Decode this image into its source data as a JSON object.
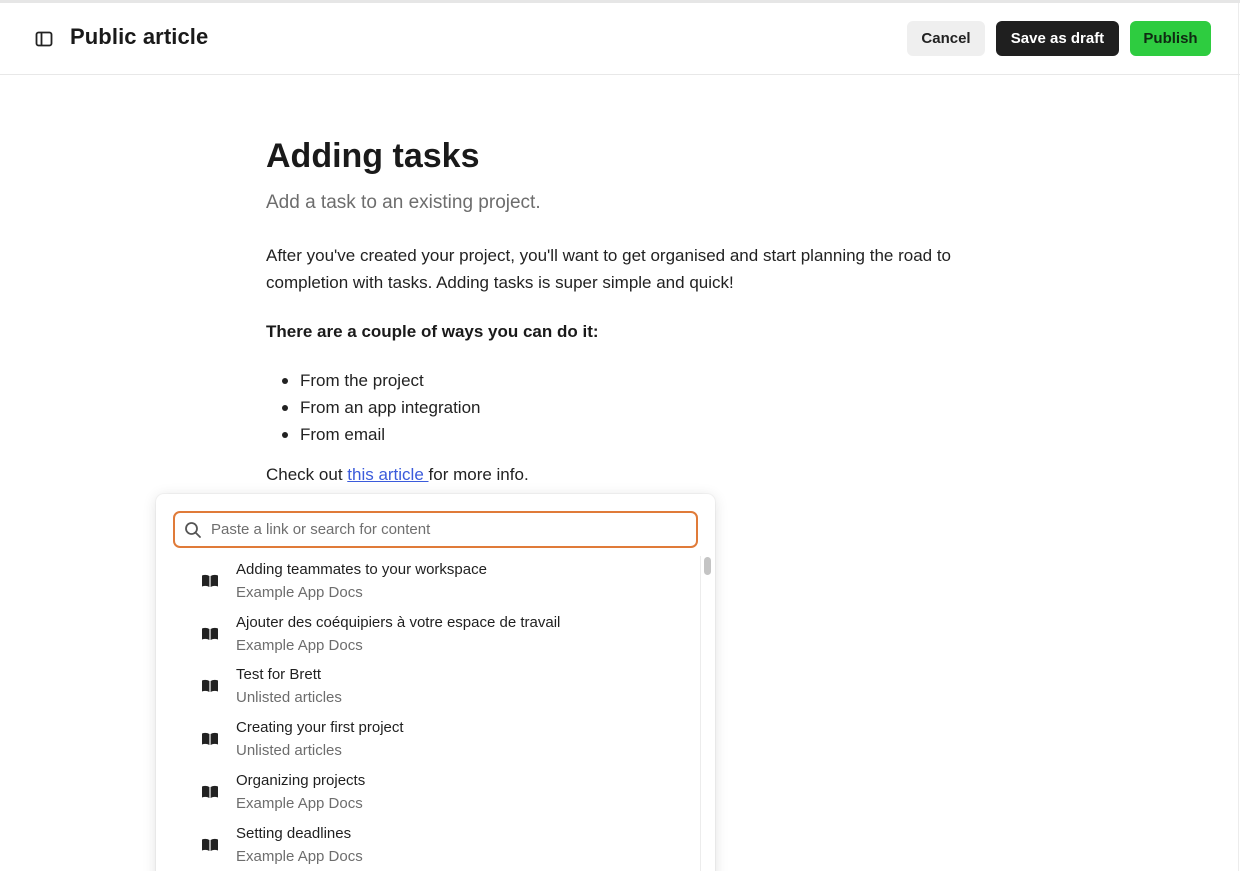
{
  "header": {
    "title": "Public article",
    "sidebar_toggle_icon": "sidebar-toggle-icon",
    "buttons": {
      "cancel": "Cancel",
      "save_draft": "Save as draft",
      "publish": "Publish"
    },
    "colors": {
      "publish": "#2ecc40",
      "draft": "#1f1f1f",
      "cancel": "#efefef"
    }
  },
  "article": {
    "title": "Adding tasks",
    "subtitle": "Add a task to an existing project.",
    "body": "After you've created your project, you'll want to get organised and start planning the road to completion with tasks. Adding tasks is super simple and quick!",
    "heading": "There are a couple of ways you can do it:",
    "bullets": [
      "From the project",
      "From an app integration",
      "From email"
    ],
    "more_info": {
      "prefix": "Check out ",
      "link": "this article ",
      "suffix": "for more info."
    },
    "link_color": "#3b5bdb"
  },
  "link_search": {
    "placeholder": "Paste a link or search for content",
    "value": "",
    "focus_color": "#e07b39",
    "results": [
      {
        "title": "Adding teammates to your workspace",
        "source": "Example App Docs",
        "icon": "book-icon"
      },
      {
        "title": "Ajouter des coéquipiers à votre espace de travail",
        "source": "Example App Docs",
        "icon": "book-icon"
      },
      {
        "title": "Test for Brett",
        "source": "Unlisted articles",
        "icon": "book-icon"
      },
      {
        "title": "Creating your first project",
        "source": "Unlisted articles",
        "icon": "book-icon"
      },
      {
        "title": "Organizing projects",
        "source": "Example App Docs",
        "icon": "book-icon"
      },
      {
        "title": "Setting deadlines",
        "source": "Example App Docs",
        "icon": "book-icon"
      }
    ]
  }
}
